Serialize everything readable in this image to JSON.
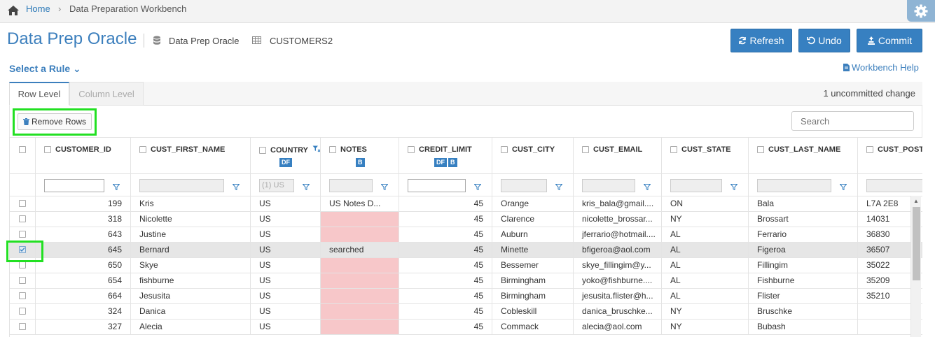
{
  "breadcrumb": {
    "home": "Home",
    "separator": "›",
    "current": "Data Preparation Workbench"
  },
  "header": {
    "title": "Data Prep Oracle",
    "connection": "Data Prep Oracle",
    "table": "CUSTOMERS2",
    "buttons": {
      "refresh": "Refresh",
      "undo": "Undo",
      "commit": "Commit"
    }
  },
  "rule_select": "Select a Rule ⌄",
  "help_link": "Workbench Help",
  "tabs": [
    {
      "label": "Row Level",
      "active": true
    },
    {
      "label": "Column Level",
      "active": false
    }
  ],
  "uncommitted": "1 uncommitted change",
  "toolbar": {
    "remove_rows": "Remove Rows",
    "search_placeholder": "Search"
  },
  "grid": {
    "columns": [
      {
        "key": "CUSTOMER_ID",
        "label": "CUSTOMER_ID",
        "badges": []
      },
      {
        "key": "CUST_FIRST_NAME",
        "label": "CUST_FIRST_NAME",
        "badges": []
      },
      {
        "key": "COUNTRY",
        "label": "COUNTRY",
        "badges": [
          "DF"
        ]
      },
      {
        "key": "NOTES",
        "label": "NOTES",
        "badges": [
          "B"
        ]
      },
      {
        "key": "CREDIT_LIMIT",
        "label": "CREDIT_LIMIT",
        "badges": [
          "DF",
          "B"
        ]
      },
      {
        "key": "CUST_CITY",
        "label": "CUST_CITY",
        "badges": []
      },
      {
        "key": "CUST_EMAIL",
        "label": "CUST_EMAIL",
        "badges": []
      },
      {
        "key": "CUST_STATE",
        "label": "CUST_STATE",
        "badges": []
      },
      {
        "key": "CUST_LAST_NAME",
        "label": "CUST_LAST_NAME",
        "badges": []
      },
      {
        "key": "CUST_POSTAL",
        "label": "CUST_POSTAL_",
        "badges": []
      }
    ],
    "filters": {
      "country_placeholder": "(1) US"
    },
    "rows": [
      {
        "selected": false,
        "cells": [
          "199",
          "Kris",
          "US",
          "US Notes D...",
          "45",
          "Orange",
          "kris_bala@gmail....",
          "ON",
          "Bala",
          "L7A 2E8"
        ],
        "pink_notes": false
      },
      {
        "selected": false,
        "cells": [
          "318",
          "Nicolette",
          "US",
          "",
          "45",
          "Clarence",
          "nicolette_brossar...",
          "NY",
          "Brossart",
          "14031"
        ],
        "pink_notes": true
      },
      {
        "selected": false,
        "cells": [
          "643",
          "Justine",
          "US",
          "",
          "45",
          "Auburn",
          "jferrario@hotmail....",
          "AL",
          "Ferrario",
          "36830"
        ],
        "pink_notes": true
      },
      {
        "selected": true,
        "cells": [
          "645",
          "Bernard",
          "US",
          "searched",
          "45",
          "Minette",
          "bfigeroa@aol.com",
          "AL",
          "Figeroa",
          "36507"
        ],
        "pink_notes": false
      },
      {
        "selected": false,
        "cells": [
          "650",
          "Skye",
          "US",
          "",
          "45",
          "Bessemer",
          "skye_fillingim@y...",
          "AL",
          "Fillingim",
          "35022"
        ],
        "pink_notes": true
      },
      {
        "selected": false,
        "cells": [
          "654",
          "fishburne",
          "US",
          "",
          "45",
          "Birmingham",
          "yoko@fishburne....",
          "AL",
          "Fishburne",
          "35209"
        ],
        "pink_notes": true
      },
      {
        "selected": false,
        "cells": [
          "664",
          "Jesusita",
          "US",
          "",
          "45",
          "Birmingham",
          "jesusita.flister@h...",
          "AL",
          "Flister",
          "35210"
        ],
        "pink_notes": true
      },
      {
        "selected": false,
        "cells": [
          "324",
          "Danica",
          "US",
          "",
          "45",
          "Cobleskill",
          "danica_bruschke...",
          "NY",
          "Bruschke",
          ""
        ],
        "pink_notes": true
      },
      {
        "selected": false,
        "cells": [
          "327",
          "Alecia",
          "US",
          "",
          "45",
          "Commack",
          "alecia@aol.com",
          "NY",
          "Bubash",
          ""
        ],
        "pink_notes": true
      }
    ]
  },
  "colors": {
    "accent": "#3780c1",
    "highlight": "#22e022",
    "pink": "#f7c7c9"
  }
}
